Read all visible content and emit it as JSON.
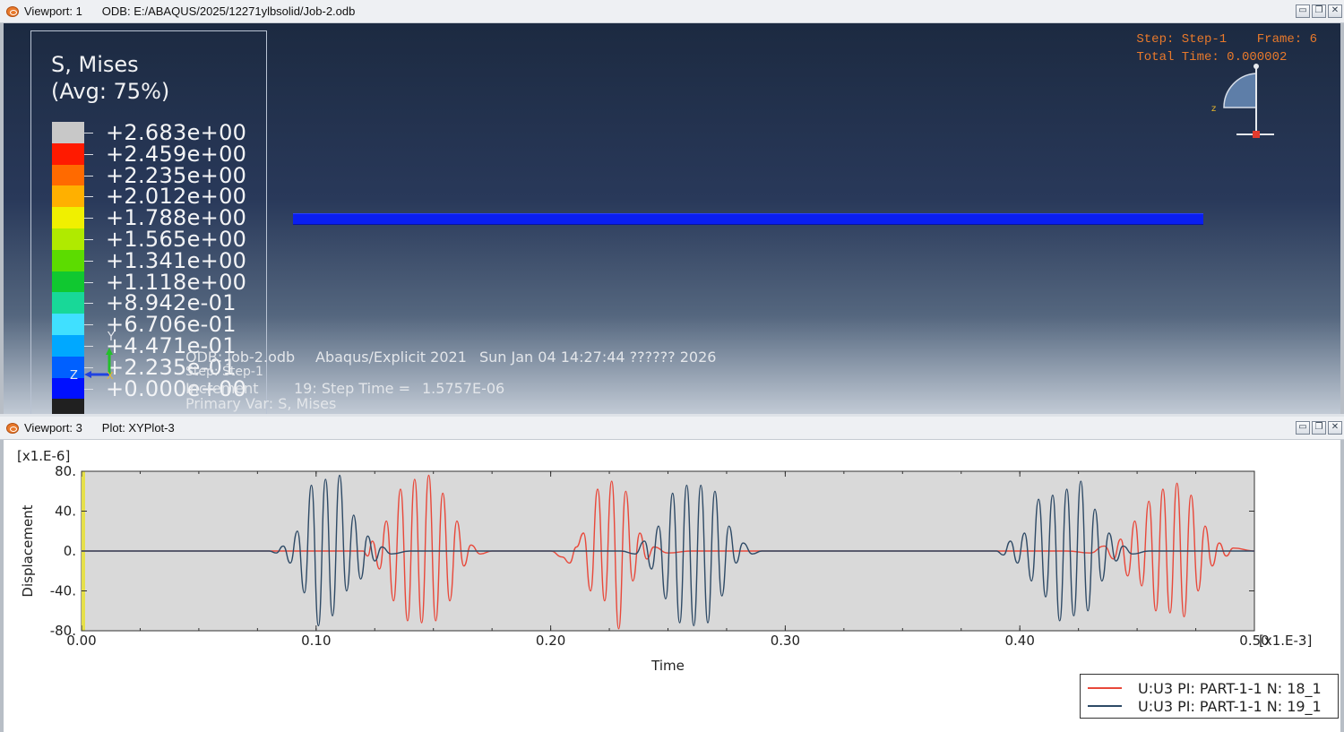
{
  "viewport1": {
    "title": "Viewport: 1",
    "odb_path": "ODB: E:/ABAQUS/2025/12271ylbsolid/Job-2.odb",
    "legend": {
      "title_line1": "S, Mises",
      "title_line2": "(Avg: 75%)",
      "labels": [
        "+2.683e+00",
        "+2.459e+00",
        "+2.235e+00",
        "+2.012e+00",
        "+1.788e+00",
        "+1.565e+00",
        "+1.341e+00",
        "+1.118e+00",
        "+8.942e-01",
        "+6.706e-01",
        "+4.471e-01",
        "+2.235e-01",
        "+0.000e+00"
      ],
      "colors": [
        "#c8c8c8",
        "#ff1a00",
        "#ff6a00",
        "#ffb000",
        "#f0f000",
        "#b0ea00",
        "#5cdc00",
        "#10c830",
        "#18d898",
        "#40e0ff",
        "#00a8ff",
        "#0060ff",
        "#0010ff",
        "#202020"
      ]
    },
    "step_info": {
      "line1": "Step: Step-1    Frame: 6",
      "line2": "Total Time: 0.000002"
    },
    "status": {
      "odb": "ODB: Job-2.odb",
      "solver": "Abaqus/Explicit 2021",
      "date": "Sun Jan 04 14:27:44 ?????? 2026",
      "step": "Step: Step-1",
      "increment": "Increment",
      "increment_value": "19: Step Time =",
      "step_time": "1.5757E-06",
      "primary_var": "Primary Var: S, Mises"
    },
    "triad_label_y": "Y",
    "triad_label_z": "Z",
    "triad_label_x": "X",
    "icon_axis": "z"
  },
  "viewport3": {
    "title": "Viewport: 3",
    "plot_name": "Plot: XYPlot-3",
    "legend_entries": [
      {
        "label": "U:U3 PI: PART-1-1 N: 18_1",
        "color": "#e8483a"
      },
      {
        "label": "U:U3 PI: PART-1-1 N: 19_1",
        "color": "#2e4a66"
      }
    ]
  },
  "window_controls": {
    "minimize": "▭",
    "restore": "❐",
    "close": "✕"
  },
  "chart_data": {
    "type": "line",
    "xlabel": "Time",
    "ylabel": "Displacement",
    "x_multiplier": "[x1.E-3]",
    "y_multiplier": "[x1.E-6]",
    "xlim": [
      0,
      0.5
    ],
    "ylim": [
      -80,
      80
    ],
    "x_ticks": [
      "0.00",
      "0.10",
      "0.20",
      "0.30",
      "0.40",
      "0.50"
    ],
    "y_ticks": [
      "80.",
      "40.",
      "0.",
      "-40.",
      "-80."
    ],
    "grid": false,
    "legend_position": "bottom-right",
    "background": "#d9d9d9",
    "series": [
      {
        "name": "U:U3 PI: PART-1-1 N: 18_1",
        "color": "#e8483a",
        "points": [
          [
            0,
            0
          ],
          [
            0.1,
            0
          ],
          [
            0.12,
            0
          ],
          [
            0.122,
            -5
          ],
          [
            0.124,
            10
          ],
          [
            0.127,
            -18
          ],
          [
            0.13,
            30
          ],
          [
            0.133,
            -50
          ],
          [
            0.136,
            62
          ],
          [
            0.139,
            -70
          ],
          [
            0.142,
            72
          ],
          [
            0.145,
            -72
          ],
          [
            0.148,
            76
          ],
          [
            0.151,
            -70
          ],
          [
            0.154,
            58
          ],
          [
            0.157,
            -50
          ],
          [
            0.16,
            30
          ],
          [
            0.163,
            -15
          ],
          [
            0.166,
            6
          ],
          [
            0.17,
            -3
          ],
          [
            0.175,
            0
          ],
          [
            0.2,
            0
          ],
          [
            0.205,
            -6
          ],
          [
            0.208,
            -12
          ],
          [
            0.211,
            4
          ],
          [
            0.214,
            18
          ],
          [
            0.217,
            -40
          ],
          [
            0.22,
            62
          ],
          [
            0.223,
            -50
          ],
          [
            0.226,
            70
          ],
          [
            0.229,
            -78
          ],
          [
            0.232,
            60
          ],
          [
            0.235,
            -30
          ],
          [
            0.238,
            18
          ],
          [
            0.241,
            -8
          ],
          [
            0.244,
            4
          ],
          [
            0.25,
            -2
          ],
          [
            0.26,
            0
          ],
          [
            0.31,
            0
          ],
          [
            0.33,
            0
          ],
          [
            0.42,
            0
          ],
          [
            0.43,
            -2
          ],
          [
            0.436,
            5
          ],
          [
            0.44,
            -8
          ],
          [
            0.443,
            12
          ],
          [
            0.446,
            -25
          ],
          [
            0.449,
            30
          ],
          [
            0.452,
            -35
          ],
          [
            0.455,
            50
          ],
          [
            0.458,
            -60
          ],
          [
            0.461,
            62
          ],
          [
            0.464,
            -62
          ],
          [
            0.467,
            68
          ],
          [
            0.47,
            -66
          ],
          [
            0.473,
            56
          ],
          [
            0.476,
            -40
          ],
          [
            0.479,
            25
          ],
          [
            0.482,
            -15
          ],
          [
            0.485,
            8
          ],
          [
            0.488,
            -5
          ],
          [
            0.491,
            3
          ],
          [
            0.5,
            0
          ]
        ]
      },
      {
        "name": "U:U3 PI: PART-1-1 N: 19_1",
        "color": "#2e4a66",
        "points": [
          [
            0,
            0
          ],
          [
            0.08,
            0
          ],
          [
            0.083,
            -2
          ],
          [
            0.086,
            5
          ],
          [
            0.089,
            -12
          ],
          [
            0.092,
            20
          ],
          [
            0.095,
            -42
          ],
          [
            0.098,
            66
          ],
          [
            0.101,
            -75
          ],
          [
            0.104,
            72
          ],
          [
            0.107,
            -65
          ],
          [
            0.11,
            76
          ],
          [
            0.113,
            -40
          ],
          [
            0.116,
            36
          ],
          [
            0.119,
            -28
          ],
          [
            0.122,
            15
          ],
          [
            0.125,
            -10
          ],
          [
            0.128,
            4
          ],
          [
            0.132,
            -3
          ],
          [
            0.14,
            0
          ],
          [
            0.23,
            0
          ],
          [
            0.236,
            -3
          ],
          [
            0.24,
            10
          ],
          [
            0.243,
            -18
          ],
          [
            0.246,
            25
          ],
          [
            0.249,
            -48
          ],
          [
            0.252,
            58
          ],
          [
            0.255,
            -72
          ],
          [
            0.258,
            66
          ],
          [
            0.261,
            -75
          ],
          [
            0.264,
            66
          ],
          [
            0.267,
            -72
          ],
          [
            0.27,
            60
          ],
          [
            0.273,
            -45
          ],
          [
            0.276,
            25
          ],
          [
            0.279,
            -12
          ],
          [
            0.282,
            8
          ],
          [
            0.286,
            -3
          ],
          [
            0.29,
            0
          ],
          [
            0.39,
            0
          ],
          [
            0.393,
            -4
          ],
          [
            0.396,
            10
          ],
          [
            0.399,
            -12
          ],
          [
            0.402,
            18
          ],
          [
            0.405,
            -30
          ],
          [
            0.408,
            52
          ],
          [
            0.411,
            -46
          ],
          [
            0.414,
            56
          ],
          [
            0.417,
            -70
          ],
          [
            0.42,
            62
          ],
          [
            0.423,
            -65
          ],
          [
            0.426,
            70
          ],
          [
            0.429,
            -60
          ],
          [
            0.432,
            42
          ],
          [
            0.435,
            -30
          ],
          [
            0.438,
            18
          ],
          [
            0.441,
            -10
          ],
          [
            0.444,
            5
          ],
          [
            0.448,
            -3
          ],
          [
            0.455,
            0
          ],
          [
            0.5,
            0
          ]
        ]
      }
    ]
  }
}
